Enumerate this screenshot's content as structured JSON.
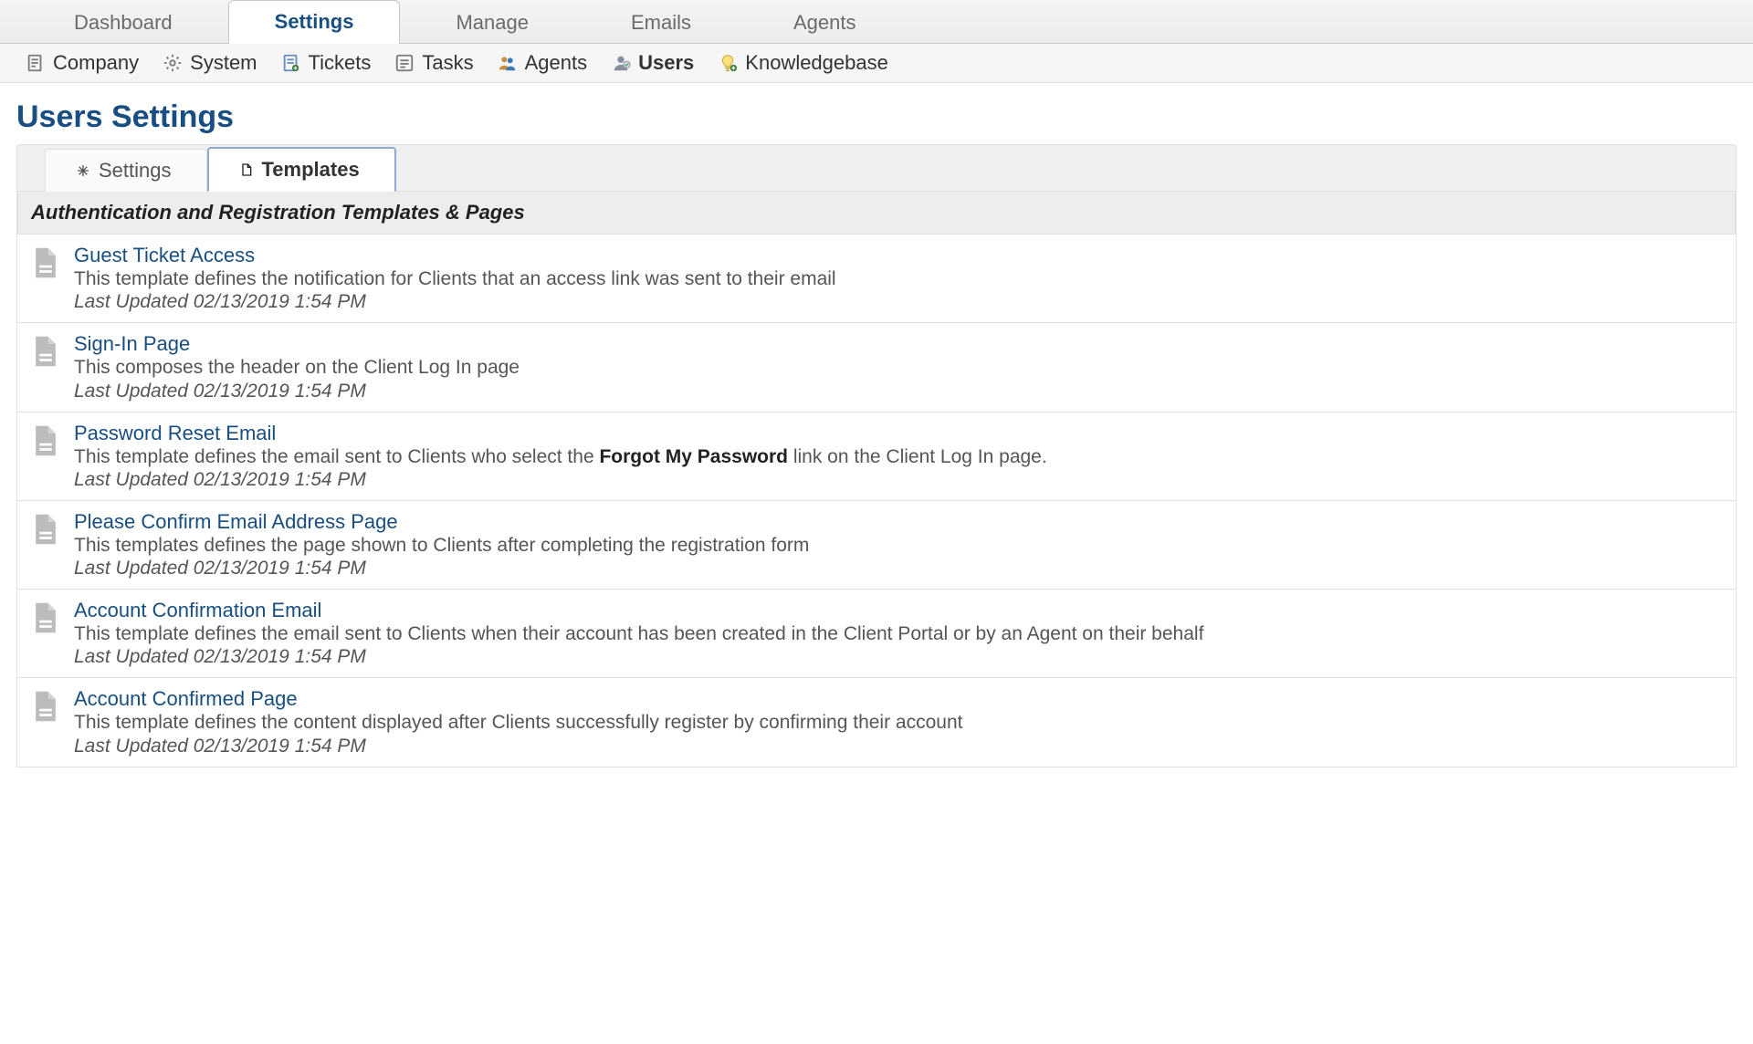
{
  "topnav": {
    "items": [
      {
        "label": "Dashboard",
        "active": false
      },
      {
        "label": "Settings",
        "active": true
      },
      {
        "label": "Manage",
        "active": false
      },
      {
        "label": "Emails",
        "active": false
      },
      {
        "label": "Agents",
        "active": false
      }
    ]
  },
  "subnav": {
    "items": [
      {
        "label": "Company",
        "icon": "document-icon",
        "active": false
      },
      {
        "label": "System",
        "icon": "gear-icon",
        "active": false
      },
      {
        "label": "Tickets",
        "icon": "ticket-icon",
        "active": false
      },
      {
        "label": "Tasks",
        "icon": "checklist-icon",
        "active": false
      },
      {
        "label": "Agents",
        "icon": "people-icon",
        "active": false
      },
      {
        "label": "Users",
        "icon": "person-icon",
        "active": true
      },
      {
        "label": "Knowledgebase",
        "icon": "bulb-icon",
        "active": false
      }
    ]
  },
  "page": {
    "title": "Users Settings"
  },
  "inner_tabs": {
    "items": [
      {
        "label": "Settings",
        "icon": "asterisk-icon",
        "active": false
      },
      {
        "label": "Templates",
        "icon": "file-icon",
        "active": true
      }
    ]
  },
  "section": {
    "header": "Authentication and Registration Templates & Pages"
  },
  "templates": [
    {
      "title": "Guest Ticket Access",
      "desc": "This template defines the notification for Clients that an access link was sent to their email",
      "updated": "Last Updated 02/13/2019 1:54 PM"
    },
    {
      "title": "Sign-In Page",
      "desc": "This composes the header on the Client Log In page",
      "updated": "Last Updated 02/13/2019 1:54 PM"
    },
    {
      "title": "Password Reset Email",
      "desc_pre": "This template defines the email sent to Clients who select the ",
      "desc_strong": "Forgot My Password",
      "desc_post": " link on the Client Log In page.",
      "updated": "Last Updated 02/13/2019 1:54 PM"
    },
    {
      "title": "Please Confirm Email Address Page",
      "desc": "This templates defines the page shown to Clients after completing the registration form",
      "updated": "Last Updated 02/13/2019 1:54 PM"
    },
    {
      "title": "Account Confirmation Email",
      "desc": "This template defines the email sent to Clients when their account has been created in the Client Portal or by an Agent on their behalf",
      "updated": "Last Updated 02/13/2019 1:54 PM"
    },
    {
      "title": "Account Confirmed Page",
      "desc": "This template defines the content displayed after Clients successfully register by confirming their account",
      "updated": "Last Updated 02/13/2019 1:54 PM"
    }
  ]
}
